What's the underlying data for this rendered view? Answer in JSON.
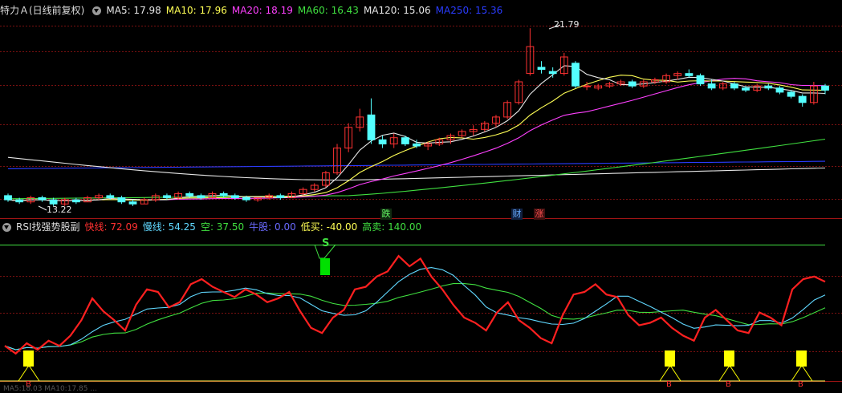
{
  "main_header": {
    "title": "特力Ａ(日线前复权)",
    "indicators": [
      {
        "name": "MA5",
        "text": "MA5: 17.98",
        "color": "#e6e6e6"
      },
      {
        "name": "MA10",
        "text": "MA10: 17.96",
        "color": "#ffff55"
      },
      {
        "name": "MA20",
        "text": "MA20: 18.19",
        "color": "#ff40ff"
      },
      {
        "name": "MA60",
        "text": "MA60: 16.43",
        "color": "#40e040"
      },
      {
        "name": "MA120",
        "text": "MA120: 15.06",
        "color": "#e6e6e6"
      },
      {
        "name": "MA250",
        "text": "MA250: 15.36",
        "color": "#2a3cff"
      }
    ]
  },
  "price_annotations": {
    "high": "21.79",
    "low": "13.22"
  },
  "events": [
    {
      "name": "drop",
      "text": "跌",
      "color": "#66ff66",
      "bg": "#103010"
    },
    {
      "name": "finance",
      "text": "财",
      "color": "#66aaff",
      "bg": "#102040"
    },
    {
      "name": "rise",
      "text": "涨",
      "color": "#ff5050",
      "bg": "#401010"
    }
  ],
  "sub_header": {
    "title": "RSI找强势股副",
    "indicators": [
      {
        "name": "fast",
        "text": "快线: 72.09",
        "color": "#ff3030"
      },
      {
        "name": "slow",
        "text": "慢线: 54.25",
        "color": "#60d8ff"
      },
      {
        "name": "empty",
        "text": "空: 37.50",
        "color": "#40e040"
      },
      {
        "name": "bull",
        "text": "牛股: 0.00",
        "color": "#6a6aff"
      },
      {
        "name": "low-buy",
        "text": "低买: -40.00",
        "color": "#ffff55"
      },
      {
        "name": "high-sell",
        "text": "高卖: 140.00",
        "color": "#40e040"
      }
    ],
    "sell_marker": "S",
    "buy_marker": "B"
  },
  "bottom_strip": "MA5:18.03 MA10:17.85 ...",
  "colors": {
    "up": "#ff3232",
    "down": "#54ffff",
    "grid": "#7a1010",
    "bg": "#000000"
  },
  "chart_data": [
    {
      "type": "candlestick",
      "title": "特力Ａ(日线前复权)",
      "series": [
        {
          "name": "MA5",
          "last": 17.98
        },
        {
          "name": "MA10",
          "last": 17.96
        },
        {
          "name": "MA20",
          "last": 18.19
        },
        {
          "name": "MA60",
          "last": 16.43
        },
        {
          "name": "MA120",
          "last": 15.06
        },
        {
          "name": "MA250",
          "last": 15.36
        }
      ],
      "ohlc": [
        [
          13.7,
          13.8,
          13.4,
          13.5
        ],
        [
          13.5,
          13.6,
          13.3,
          13.4
        ],
        [
          13.4,
          13.7,
          13.3,
          13.6
        ],
        [
          13.6,
          13.7,
          13.4,
          13.5
        ],
        [
          13.5,
          13.6,
          13.2,
          13.3
        ],
        [
          13.3,
          13.6,
          13.2,
          13.5
        ],
        [
          13.5,
          13.6,
          13.3,
          13.4
        ],
        [
          13.4,
          13.7,
          13.4,
          13.6
        ],
        [
          13.6,
          13.8,
          13.5,
          13.7
        ],
        [
          13.7,
          13.8,
          13.5,
          13.6
        ],
        [
          13.6,
          13.7,
          13.3,
          13.4
        ],
        [
          13.4,
          13.5,
          13.2,
          13.3
        ],
        [
          13.3,
          13.6,
          13.3,
          13.5
        ],
        [
          13.5,
          13.8,
          13.4,
          13.7
        ],
        [
          13.7,
          13.8,
          13.5,
          13.6
        ],
        [
          13.6,
          13.9,
          13.5,
          13.8
        ],
        [
          13.8,
          13.9,
          13.6,
          13.7
        ],
        [
          13.7,
          13.8,
          13.5,
          13.6
        ],
        [
          13.6,
          13.9,
          13.6,
          13.8
        ],
        [
          13.8,
          13.9,
          13.6,
          13.7
        ],
        [
          13.7,
          13.8,
          13.5,
          13.6
        ],
        [
          13.6,
          13.7,
          13.4,
          13.5
        ],
        [
          13.5,
          13.6,
          13.4,
          13.6
        ],
        [
          13.6,
          13.8,
          13.5,
          13.7
        ],
        [
          13.7,
          13.8,
          13.5,
          13.6
        ],
        [
          13.6,
          13.9,
          13.6,
          13.8
        ],
        [
          13.8,
          14.1,
          13.7,
          14.0
        ],
        [
          14.0,
          14.3,
          13.9,
          14.2
        ],
        [
          14.2,
          14.9,
          14.1,
          14.8
        ],
        [
          14.8,
          16.2,
          14.7,
          16.0
        ],
        [
          16.0,
          17.2,
          15.8,
          17.0
        ],
        [
          17.0,
          17.9,
          16.8,
          17.5
        ],
        [
          17.6,
          18.4,
          16.2,
          16.4
        ],
        [
          16.4,
          16.6,
          16.0,
          16.2
        ],
        [
          16.2,
          16.7,
          16.0,
          16.5
        ],
        [
          16.5,
          16.6,
          16.1,
          16.2
        ],
        [
          16.2,
          16.4,
          16.0,
          16.1
        ],
        [
          16.1,
          16.3,
          15.9,
          16.2
        ],
        [
          16.2,
          16.5,
          16.1,
          16.4
        ],
        [
          16.4,
          16.7,
          16.2,
          16.6
        ],
        [
          16.6,
          16.9,
          16.5,
          16.8
        ],
        [
          16.8,
          17.1,
          16.6,
          16.9
        ],
        [
          16.9,
          17.3,
          16.8,
          17.2
        ],
        [
          17.2,
          17.6,
          17.0,
          17.5
        ],
        [
          17.5,
          18.3,
          17.4,
          18.2
        ],
        [
          18.2,
          19.3,
          18.1,
          19.2
        ],
        [
          19.6,
          21.79,
          19.5,
          20.9
        ],
        [
          19.9,
          20.2,
          19.6,
          19.8
        ],
        [
          19.7,
          19.9,
          19.4,
          19.6
        ],
        [
          19.6,
          20.6,
          19.5,
          20.4
        ],
        [
          20.1,
          20.2,
          18.9,
          19.0
        ],
        [
          19.0,
          19.2,
          18.8,
          19.0
        ],
        [
          18.9,
          19.1,
          18.8,
          19.0
        ],
        [
          19.0,
          19.2,
          18.9,
          19.1
        ],
        [
          19.1,
          19.3,
          19.0,
          19.2
        ],
        [
          19.2,
          19.3,
          18.9,
          19.0
        ],
        [
          19.0,
          19.3,
          18.9,
          19.2
        ],
        [
          19.2,
          19.4,
          19.1,
          19.3
        ],
        [
          19.2,
          19.6,
          19.1,
          19.5
        ],
        [
          19.5,
          19.7,
          19.3,
          19.6
        ],
        [
          19.6,
          19.8,
          19.4,
          19.5
        ],
        [
          19.5,
          19.6,
          19.0,
          19.1
        ],
        [
          19.1,
          19.3,
          18.8,
          18.9
        ],
        [
          18.9,
          19.2,
          18.8,
          19.1
        ],
        [
          19.1,
          19.2,
          18.8,
          18.9
        ],
        [
          18.9,
          19.0,
          18.7,
          18.8
        ],
        [
          18.8,
          19.1,
          18.7,
          19.0
        ],
        [
          19.0,
          19.1,
          18.8,
          18.9
        ],
        [
          18.9,
          19.0,
          18.6,
          18.7
        ],
        [
          18.7,
          18.8,
          18.4,
          18.5
        ],
        [
          18.5,
          18.6,
          18.0,
          18.2
        ],
        [
          18.2,
          19.2,
          18.1,
          19.0
        ],
        [
          19.0,
          19.1,
          18.6,
          18.8
        ]
      ]
    },
    {
      "type": "line",
      "title": "RSI找强势股副",
      "series": [
        {
          "name": "快线",
          "last": 72.09
        },
        {
          "name": "慢线",
          "last": 54.25
        },
        {
          "name": "空",
          "last": 37.5
        },
        {
          "name": "牛股",
          "last": 0.0
        },
        {
          "name": "低买",
          "last": -40.0
        },
        {
          "name": "高卖",
          "last": 140.0
        }
      ]
    }
  ]
}
